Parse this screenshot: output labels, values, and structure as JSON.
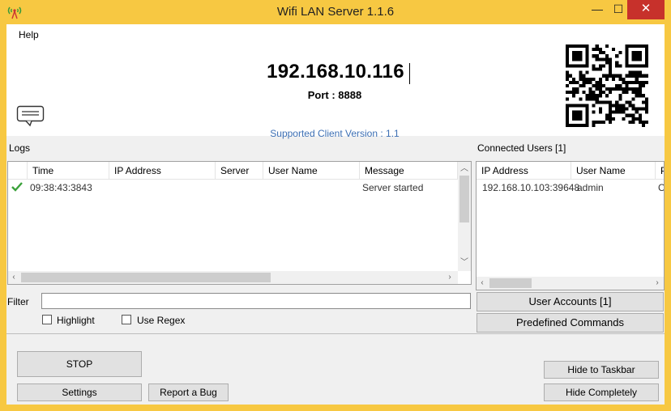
{
  "window": {
    "title": "Wifi LAN Server 1.1.6",
    "minimize_glyph": "—",
    "maximize_glyph": "☐",
    "close_glyph": "✕"
  },
  "menu": {
    "help": "Help"
  },
  "server": {
    "ip": "192.168.10.116",
    "port_text": "Port : 8888",
    "client_version_text": "Supported Client Version : 1.1"
  },
  "logs": {
    "label": "Logs",
    "columns": [
      "Time",
      "IP Address",
      "Server",
      "User Name",
      "Message"
    ],
    "rows": [
      {
        "status_icon": "check-icon",
        "time": "09:38:43:3843",
        "ip": "",
        "server": "",
        "user": "",
        "message": "Server started"
      }
    ]
  },
  "connected_users": {
    "label": "Connected Users [1]",
    "columns": [
      "IP Address",
      "User Name",
      "P"
    ],
    "rows": [
      {
        "ip": "192.168.10.103:39648",
        "user": "admin",
        "extra": "C"
      }
    ]
  },
  "filter": {
    "label": "Filter",
    "value": "",
    "highlight_label": "Highlight",
    "highlight_checked": false,
    "regex_label": "Use Regex",
    "regex_checked": false
  },
  "buttons": {
    "user_accounts": "User Accounts [1]",
    "predefined_commands": "Predefined Commands",
    "stop": "STOP",
    "settings": "Settings",
    "report_bug": "Report a Bug",
    "hide_taskbar": "Hide to Taskbar",
    "hide_completely": "Hide Completely"
  },
  "colors": {
    "frame": "#f7c842",
    "close_button": "#c7312b",
    "version_text": "#3c6fb4",
    "check": "#3aa13a"
  }
}
